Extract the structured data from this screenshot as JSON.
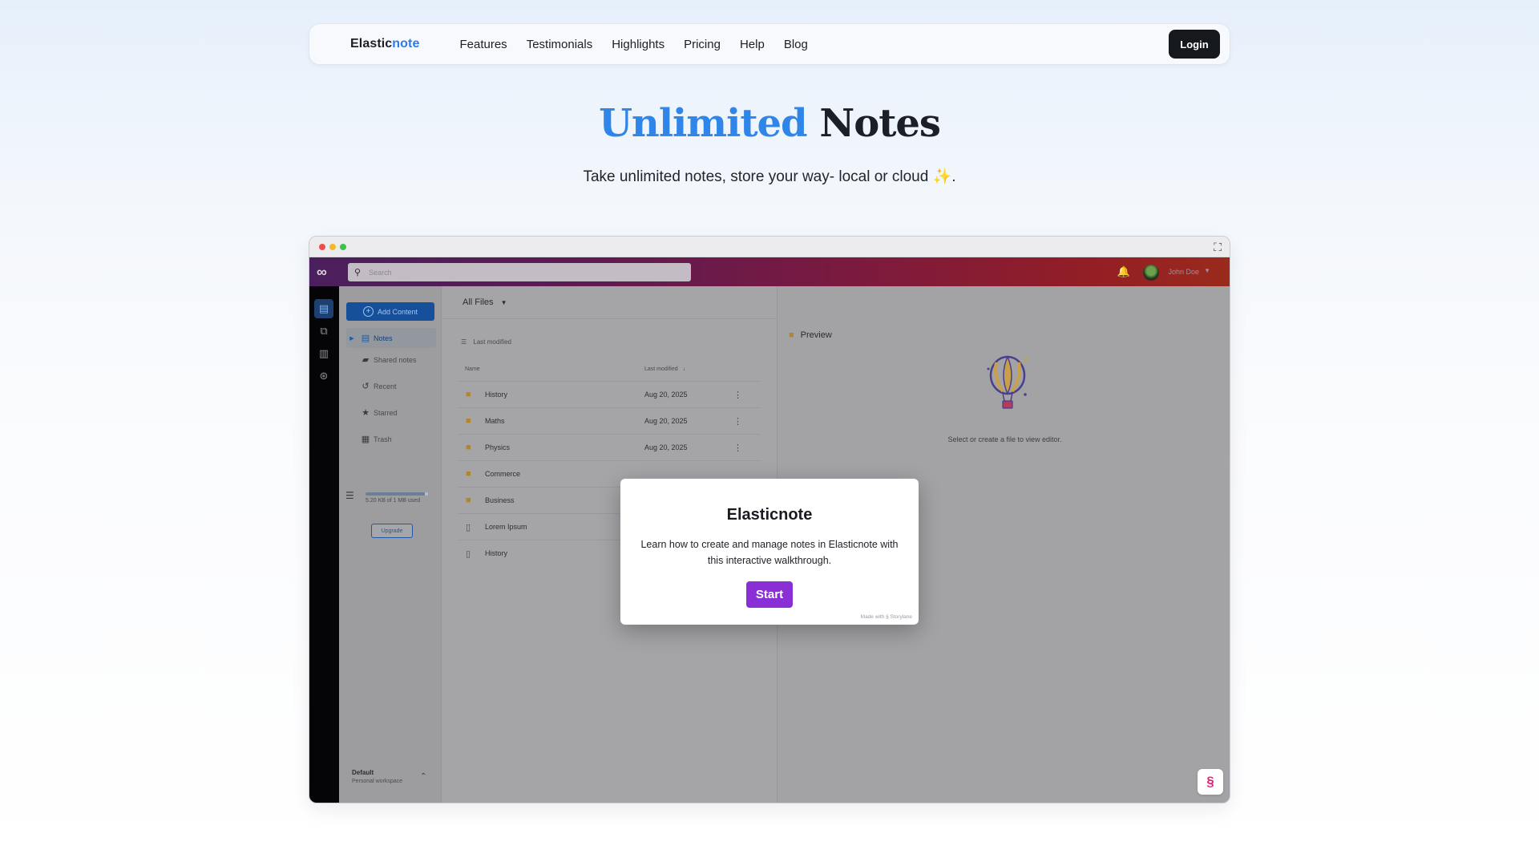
{
  "nav": {
    "brand_main": "Elastic",
    "brand_accent": "note",
    "links": [
      "Features",
      "Testimonials",
      "Highlights",
      "Pricing",
      "Help",
      "Blog"
    ],
    "login_label": "Login"
  },
  "hero": {
    "title_accent": "Unlimited",
    "title_rest": "Notes",
    "subtitle": "Take unlimited notes, store your way- local or cloud",
    "subtitle_emoji": "✨",
    "subtitle_end": "."
  },
  "app": {
    "search_placeholder": "Search",
    "user_name": "John Doe",
    "add_content_label": "Add Content",
    "sidebar_items": [
      {
        "label": "Notes",
        "icon": "notes-icon",
        "active": true
      },
      {
        "label": "Shared notes",
        "icon": "shared-folder-icon"
      },
      {
        "label": "Recent",
        "icon": "history-icon"
      },
      {
        "label": "Starred",
        "icon": "star-icon"
      },
      {
        "label": "Trash",
        "icon": "trash-icon"
      }
    ],
    "storage_text": "5.20 KB of 1 MB used",
    "storage_progress": 0.95,
    "upgrade_label": "Upgrade",
    "workspace_name": "Default",
    "workspace_sub": "Personal workspace",
    "all_files_label": "All Files",
    "sort_label": "Last modified",
    "col_name": "Name",
    "col_modified": "Last modified",
    "files": [
      {
        "name": "History",
        "type": "folder",
        "date": "Aug 20, 2025"
      },
      {
        "name": "Maths",
        "type": "folder",
        "date": "Aug 20, 2025"
      },
      {
        "name": "Physics",
        "type": "folder",
        "date": "Aug 20, 2025"
      },
      {
        "name": "Commerce",
        "type": "folder",
        "date": ""
      },
      {
        "name": "Business",
        "type": "folder",
        "date": ""
      },
      {
        "name": "Lorem Ipsum",
        "type": "doc",
        "date": ""
      },
      {
        "name": "History",
        "type": "doc",
        "date": ""
      }
    ],
    "preview_title": "Preview",
    "preview_message": "Select or create a file to view editor."
  },
  "modal": {
    "title": "Elasticnote",
    "body": "Learn how to create and manage notes in Elasticnote with this interactive walkthrough.",
    "start_label": "Start",
    "made_with": "Made with",
    "made_with_brand": "Storylane"
  },
  "colors": {
    "accent_blue": "#2f86e8",
    "start_purple": "#8a2fd6",
    "login_dark": "#15181d"
  }
}
